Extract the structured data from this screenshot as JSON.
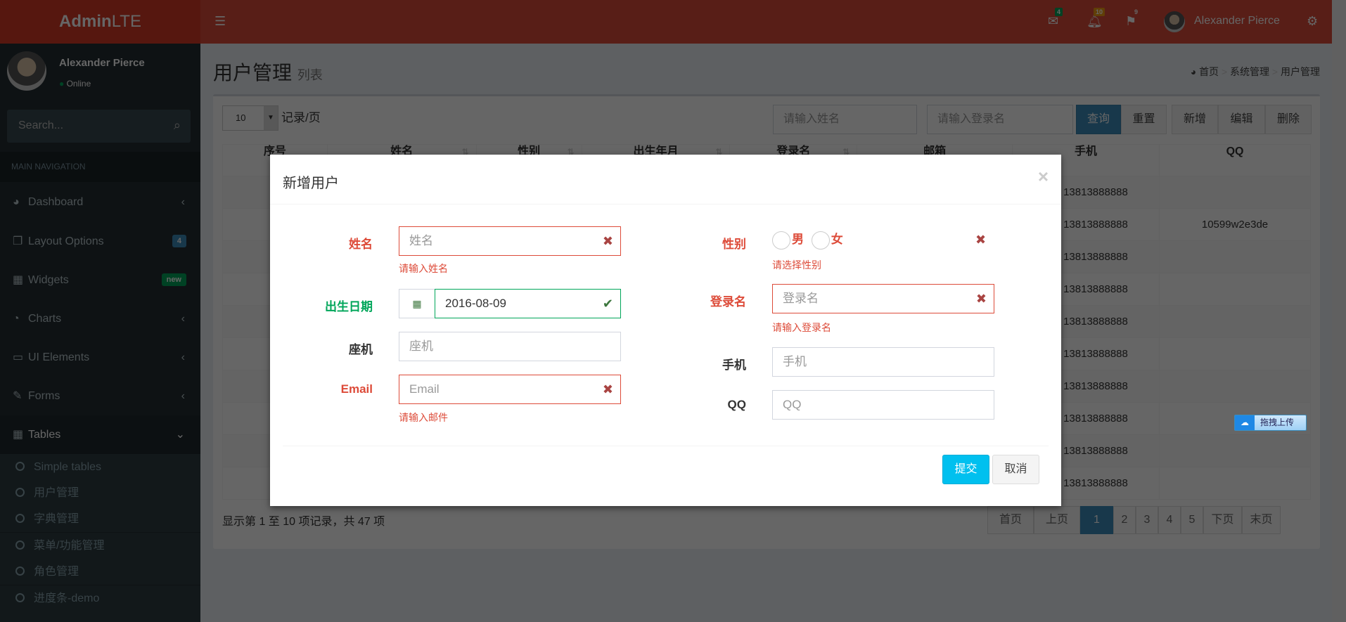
{
  "brand": {
    "bold": "Admin",
    "light": "LTE"
  },
  "header": {
    "messages_count": "4",
    "notifications_count": "10",
    "tasks_count": "9",
    "user_name": "Alexander Pierce"
  },
  "colors": {
    "primary": "#dd4b39",
    "success": "#00a65a",
    "info": "#00c0ef",
    "pagination_active": "#3c8dbc"
  },
  "user_panel": {
    "name": "Alexander Pierce",
    "status": "Online"
  },
  "sidebar": {
    "search_placeholder": "Search...",
    "nav_header": "MAIN NAVIGATION",
    "items": [
      {
        "label": "Dashboard",
        "icon": "dashboard-icon"
      },
      {
        "label": "Layout Options",
        "icon": "files-icon",
        "badge": "4"
      },
      {
        "label": "Widgets",
        "icon": "th-icon",
        "badge": "new"
      },
      {
        "label": "Charts",
        "icon": "pie-chart-icon"
      },
      {
        "label": "UI Elements",
        "icon": "laptop-icon"
      },
      {
        "label": "Forms",
        "icon": "edit-icon"
      },
      {
        "label": "Tables",
        "icon": "table-icon"
      }
    ],
    "subitems": [
      "Simple tables",
      "用户管理",
      "字典管理",
      "菜单/功能管理",
      "角色管理",
      "进度条-demo"
    ]
  },
  "page": {
    "title": "用户管理",
    "subtitle": "列表",
    "breadcrumb": [
      "首页",
      "系统管理",
      "用户管理"
    ]
  },
  "toolbar": {
    "page_size": "10",
    "page_size_label": "记录/页",
    "name_placeholder": "请输入姓名",
    "login_placeholder": "请输入登录名",
    "query": "查询",
    "reset": "重置",
    "add": "新增",
    "edit": "编辑",
    "delete": "删除"
  },
  "table": {
    "columns": [
      "序号",
      "姓名",
      "性别",
      "出生年月",
      "登录名",
      "邮箱",
      "手机",
      "QQ"
    ],
    "phones": [
      "13813888888",
      "13813888888",
      "13813888888",
      "13813888888",
      "13813888888",
      "13813888888",
      "13813888888",
      "13813888888",
      "13813888888",
      "13813888888"
    ],
    "qq": [
      "",
      "10599w2e3de",
      "",
      "",
      "",
      "",
      "",
      "",
      "",
      ""
    ]
  },
  "footer": {
    "info": "显示第 1 至 10 项记录，共 47 项",
    "pages": [
      "首页",
      "上页",
      "1",
      "2",
      "3",
      "4",
      "5",
      "下页",
      "末页"
    ],
    "active_page": "1"
  },
  "upload": {
    "label": "拖拽上传"
  },
  "modal": {
    "title": "新增用户",
    "name": {
      "label": "姓名",
      "placeholder": "姓名",
      "error": "请输入姓名"
    },
    "birth": {
      "label": "出生日期",
      "value": "2016-08-09"
    },
    "tel": {
      "label": "座机",
      "placeholder": "座机"
    },
    "email": {
      "label": "Email",
      "placeholder": "Email",
      "error": "请输入邮件"
    },
    "gender": {
      "label": "性别",
      "male": "男",
      "female": "女",
      "error": "请选择性别"
    },
    "login": {
      "label": "登录名",
      "placeholder": "登录名",
      "error": "请输入登录名"
    },
    "mobile": {
      "label": "手机",
      "placeholder": "手机"
    },
    "qq": {
      "label": "QQ",
      "placeholder": "QQ"
    },
    "submit": "提交",
    "cancel": "取消"
  }
}
